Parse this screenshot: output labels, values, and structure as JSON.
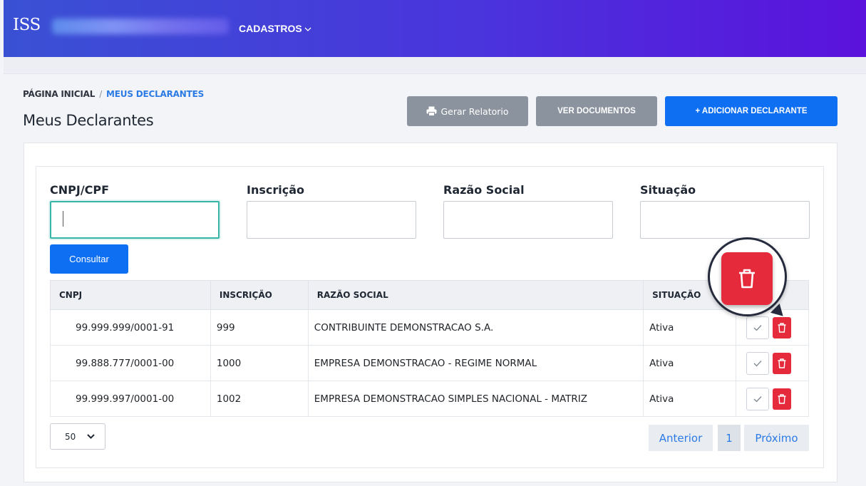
{
  "header": {
    "brand": "ISS",
    "nav_cadastros": "CADASTROS"
  },
  "breadcrumb": {
    "home": "PÁGINA INICIAL",
    "separator": "/",
    "current": "MEUS DECLARANTES"
  },
  "page": {
    "title": "Meus Declarantes"
  },
  "toolbar": {
    "report_label": "Gerar Relatorio",
    "docs_label": "VER DOCUMENTOS",
    "add_label": "+ ADICIONAR DECLARANTE"
  },
  "filters": {
    "cnpj_label": "CNPJ/CPF",
    "cnpj_value": "",
    "inscricao_label": "Inscrição",
    "inscricao_value": "",
    "razao_label": "Razão Social",
    "razao_value": "",
    "situacao_label": "Situação",
    "situacao_value": "",
    "submit_label": "Consultar"
  },
  "table": {
    "columns": [
      "CNPJ",
      "INSCRIÇÃO",
      "RAZÃO SOCIAL",
      "SITUAÇÃO",
      ""
    ],
    "rows": [
      {
        "cnpj": "99.999.999/0001-91",
        "inscricao": "999",
        "razao": "CONTRIBUINTE DEMONSTRACAO S.A.",
        "situacao": "Ativa"
      },
      {
        "cnpj": "99.888.777/0001-00",
        "inscricao": "1000",
        "razao": "EMPRESA DEMONSTRACAO - REGIME NORMAL",
        "situacao": "Ativa"
      },
      {
        "cnpj": "99.999.997/0001-00",
        "inscricao": "1002",
        "razao": "EMPRESA DEMONSTRACAO SIMPLES NACIONAL - MATRIZ",
        "situacao": "Ativa"
      }
    ]
  },
  "footer": {
    "page_size": "50",
    "prev_label": "Anterior",
    "current_page": "1",
    "next_label": "Próximo"
  },
  "icons": {
    "printer": "printer-icon",
    "chevron": "chevron-down-icon",
    "check": "check-icon",
    "trash": "trash-icon"
  },
  "colors": {
    "header_gradient_start": "#3a51d4",
    "header_gradient_end": "#5b12dc",
    "primary": "#0f6ff2",
    "secondary": "#8a939e",
    "danger": "#e52a3c",
    "link": "#2c7be5",
    "focus": "#38b4a6"
  }
}
